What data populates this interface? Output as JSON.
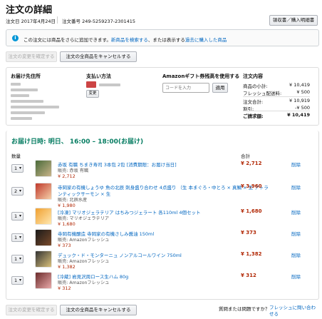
{
  "page": {
    "title": "注文の詳細",
    "order_date": "注文日 2017年4月24日",
    "order_number": "注文番号 249-5259237-2301415",
    "receipt_button": "領収書／購入明細書"
  },
  "alert": {
    "icon": "info-icon",
    "text_pre": "この注文には商品をさらに追加できます。",
    "link1": "新商品を検索する",
    "text_mid": "、または表示する",
    "link2": "過去に購入した商品"
  },
  "actions": {
    "change_order": "注文の変更を確定する",
    "cancel_all": "注文の全商品をキャンセルする"
  },
  "shipping": {
    "heading": "お届け先住所"
  },
  "payment": {
    "heading": "支払い方法",
    "change_label": "変更"
  },
  "gift": {
    "heading": "Amazonギフト券残高を使用する",
    "placeholder": "コードを入力",
    "apply_label": "適用"
  },
  "summary": {
    "heading": "注文内容",
    "rows": [
      {
        "label": "商品の小計:",
        "value": "¥ 10,419"
      },
      {
        "label": "フレッシュ配送料:",
        "value": "¥ 500"
      },
      {
        "label": "注文合計:",
        "value": "¥ 10,919"
      },
      {
        "label": "割引:",
        "value": "-¥ 500"
      },
      {
        "label": "ご請求額:",
        "value": "¥ 10,419"
      }
    ]
  },
  "delivery": {
    "text": "お届け日時: 明日、 16:00 – 18:00(お届け)"
  },
  "table": {
    "qty_header": "数量",
    "total_header": "合計",
    "delete_label": "削除",
    "items": [
      {
        "qty": "1",
        "name": "赤坂 有職 ちまき寿司 3本包 2包 [消費期限：お届け当日]",
        "name2": "",
        "seller": "販売: 赤坂 有職",
        "price": "¥ 2,712",
        "total": "¥ 2,712"
      },
      {
        "qty": "2",
        "name": "寺岡家の有機しょうゆ 魚の北辰 刺身盛り合わせ 4点盛り （生 本まぐろ・中とろ × 真鯛 × 生 アトラ",
        "name2": "ンティックサーモン × 生",
        "seller": "販売: 北辰水産",
        "price": "¥ 1,980",
        "total": "¥ 3,960"
      },
      {
        "qty": "1",
        "name": "[冷凍] マリオジェラテリア はちみつジェラート 各110ml 4個セット",
        "name2": "",
        "seller": "販売: マリオジェラテリア",
        "price": "¥ 1,680",
        "total": "¥ 1,680"
      },
      {
        "qty": "1",
        "name": "寺岡有機醸造 寺岡家の有機さしみ醤油 150ml",
        "name2": "",
        "seller": "販売: Amazonフレッシュ",
        "price": "¥ 373",
        "total": "¥ 373"
      },
      {
        "qty": "1",
        "name": "デュック・ド・モンターニュ ノンアルコールワイン 750ml",
        "name2": "",
        "seller": "販売: Amazonフレッシュ",
        "price": "¥ 1,382",
        "total": "¥ 1,382"
      },
      {
        "qty": "1",
        "name": "[冷蔵] 岩見沢周ロース生ハム 80g",
        "name2": "",
        "seller": "販売: Amazonフレッシュ",
        "price": "¥ 312",
        "total": "¥ 312"
      }
    ]
  },
  "footer": {
    "question": "質問または問題ですか？",
    "contact_link": "フレッシュに問い合わせる"
  }
}
